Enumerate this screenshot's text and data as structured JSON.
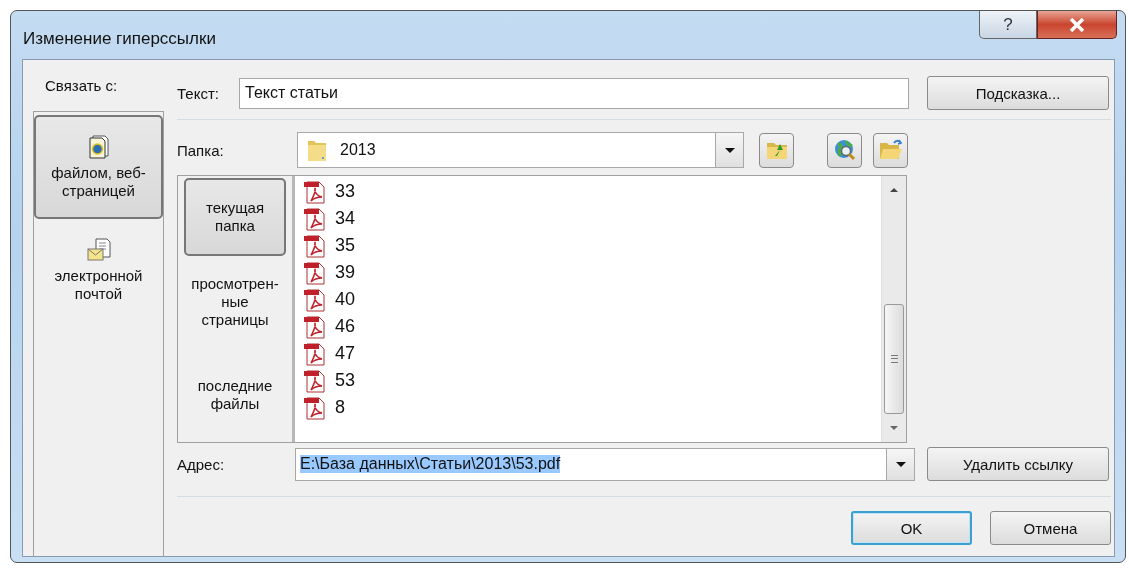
{
  "window": {
    "title": "Изменение гиперссылки",
    "help": "?"
  },
  "link_to": {
    "label": "Связать с:",
    "items": [
      {
        "kind": "file",
        "lines": [
          "файлом, веб-",
          "страницей"
        ],
        "selected": true
      },
      {
        "kind": "email",
        "lines": [
          "электронной",
          "почтой"
        ],
        "selected": false
      }
    ]
  },
  "text_field": {
    "label": "Текст:",
    "value": "Текст статьи"
  },
  "hint_button": "Подсказка...",
  "folder": {
    "label": "Папка:",
    "value": "2013"
  },
  "browse": [
    {
      "lines": [
        "текущая",
        "папка"
      ],
      "selected": true
    },
    {
      "lines": [
        "просмотрен-",
        "ные",
        "страницы"
      ],
      "selected": false
    },
    {
      "lines": [
        "последние",
        "файлы"
      ],
      "selected": false
    }
  ],
  "files": [
    "33",
    "34",
    "35",
    "39",
    "40",
    "46",
    "47",
    "53",
    "8"
  ],
  "address": {
    "label": "Адрес:",
    "value": "E:\\База данных\\Статьи\\2013\\53.pdf",
    "selected": true
  },
  "remove_link_button": "Удалить ссылку",
  "buttons": [
    {
      "label": "OK",
      "default": true
    },
    {
      "label": "Отмена",
      "default": false
    }
  ]
}
